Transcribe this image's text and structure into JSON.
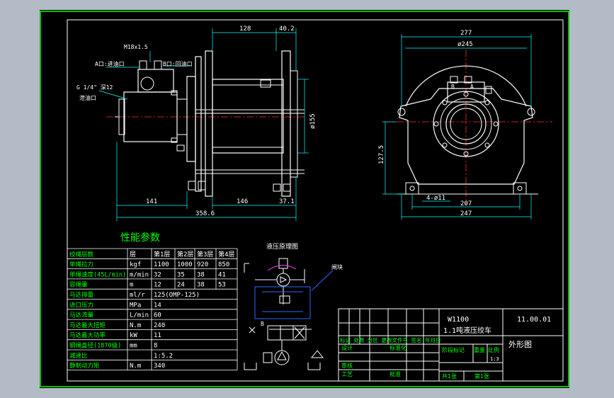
{
  "colors": {
    "background": "#b3bcc6",
    "sheet": "#000000",
    "border": "#00ff00",
    "outline": "#ffffff",
    "dimension": "#00ffff",
    "centerline": "#ff3030",
    "hydraulic": "#3366ff",
    "label": "#ffff00",
    "table_text": "#00ff00"
  },
  "front_view": {
    "dims": {
      "d128": "128",
      "d40_2": "40.2",
      "d155": "ø155",
      "d141": "141",
      "d146": "146",
      "d37_1": "37.1",
      "d358_6": "358.6"
    },
    "notes": {
      "m18": "M18x1.5",
      "port_a": "A口:进油口",
      "port_b": "B口:回油口",
      "g14": "G 1/4\" 深12",
      "drain": "泄油口"
    }
  },
  "side_view": {
    "dims": {
      "d277": "277",
      "d245": "ø245",
      "d127_5": "127.5",
      "d4_11": "4-ø11",
      "d207": "207",
      "d247": "247"
    },
    "ports": {
      "b": "B",
      "a": "A"
    }
  },
  "performance": {
    "title": "性能参数",
    "rows": [
      [
        "绞绳层数",
        "层",
        "第1层",
        "第2层",
        "第3层",
        "第4层"
      ],
      [
        "单绳拉力",
        "kgf",
        "1100",
        "1000",
        "920",
        "850"
      ],
      [
        "单绳速度(45L/min)",
        "m/min",
        "32",
        "35",
        "38",
        "41"
      ],
      [
        "容绳量",
        "m",
        "12",
        "24",
        "38",
        "53"
      ],
      [
        "马达排量",
        "ml/r",
        "125(OMP-125)",
        "",
        "",
        ""
      ],
      [
        "进口压力",
        "MPa",
        "14",
        "",
        "",
        ""
      ],
      [
        "马达流量",
        "L/min",
        "60",
        "",
        "",
        ""
      ],
      [
        "马达最大扭矩",
        "N.m",
        "240",
        "",
        "",
        ""
      ],
      [
        "马达最大功率",
        "kW",
        "11",
        "",
        "",
        ""
      ],
      [
        "钢绳直径(1870级)",
        "mm",
        "8",
        "",
        "",
        ""
      ],
      [
        "减速比",
        "",
        "1:5.2",
        "",
        "",
        ""
      ],
      [
        "静制动力矩",
        "N.m",
        "340",
        "",
        "",
        ""
      ]
    ]
  },
  "hydraulic": {
    "title": "液压原理图",
    "valve_label": "闸块",
    "port_b": "B"
  },
  "title_block": {
    "model": "W1100",
    "drawing_no": "11.00.01",
    "name": "1.1吨液压绞车",
    "view_name": "外形图",
    "header_row": "标记 处数 分区 更改文件号 签名 年月日",
    "design": "设计",
    "standardize": "标准化",
    "check": "审核",
    "process": "工艺",
    "approve": "批准",
    "stage_marks": "阶段标记",
    "weight": "重量",
    "scale": "比例",
    "scale_value": "1:3",
    "sheets": "共1张",
    "sheet_no": "第1张"
  }
}
